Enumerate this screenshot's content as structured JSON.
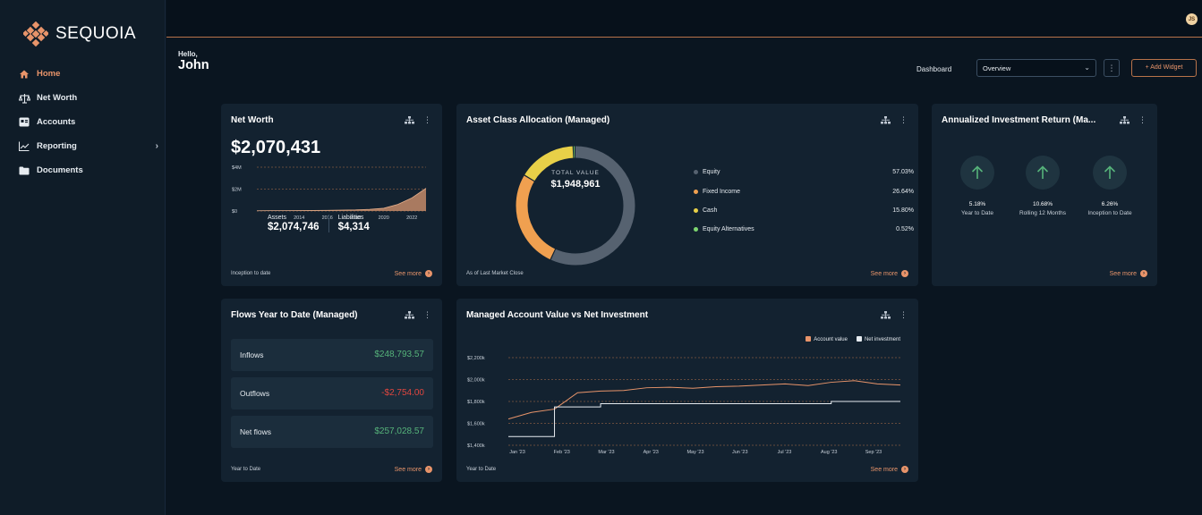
{
  "brand": {
    "name": "SEQUOIA",
    "accent": "#e8946a"
  },
  "sidebar": {
    "items": [
      {
        "label": "Home",
        "icon": "home-icon",
        "active": true
      },
      {
        "label": "Net Worth",
        "icon": "scale-icon"
      },
      {
        "label": "Accounts",
        "icon": "accounts-icon"
      },
      {
        "label": "Reporting",
        "icon": "chart-line-icon",
        "has_submenu": true
      },
      {
        "label": "Documents",
        "icon": "folder-icon"
      }
    ]
  },
  "header": {
    "avatar_initials": "JS",
    "hello": "Hello,",
    "name": "John"
  },
  "toolbar": {
    "dashboard_label": "Dashboard",
    "dashboard_selected": "Overview",
    "kebab": "⋮",
    "add_widget": "+ Add Widget"
  },
  "net_worth": {
    "title": "Net Worth",
    "value": "$2,070,431",
    "assets_label": "Assets",
    "assets_value": "$2,074,746",
    "liabilities_label": "Liabilities",
    "liabilities_value": "$4,314",
    "footer": "Inception to date",
    "see_more": "See more",
    "chart_data": {
      "type": "area",
      "y_ticks": [
        "$4M",
        "$2M",
        "$0"
      ],
      "x_ticks": [
        "2014",
        "2016",
        "2018",
        "2020",
        "2022"
      ],
      "ylim": [
        0,
        4
      ],
      "x": [
        2011,
        2012,
        2013,
        2014,
        2015,
        2016,
        2017,
        2018,
        2019,
        2020,
        2021,
        2022,
        2023
      ],
      "values": [
        0.02,
        0.03,
        0.03,
        0.04,
        0.05,
        0.06,
        0.08,
        0.1,
        0.15,
        0.25,
        0.6,
        1.2,
        2.07
      ]
    }
  },
  "allocation": {
    "title": "Asset Class Allocation (Managed)",
    "center_label": "TOTAL VALUE",
    "center_value": "$1,948,961",
    "footer": "As of Last Market Close",
    "see_more": "See more",
    "chart_data": {
      "type": "pie",
      "categories": [
        "Equity",
        "Fixed Income",
        "Cash",
        "Equity Alternatives"
      ],
      "values": [
        57.03,
        26.64,
        15.8,
        0.52
      ],
      "labels": [
        "57.03%",
        "26.64%",
        "15.80%",
        "0.52%"
      ],
      "colors": [
        "#566270",
        "#f0a050",
        "#e8d048",
        "#7ed670"
      ]
    }
  },
  "returns": {
    "title": "Annualized Investment Return (Ma...",
    "items": [
      {
        "value": "5.18%",
        "label": "Year to Date"
      },
      {
        "value": "10.68%",
        "label": "Rolling 12 Months"
      },
      {
        "value": "6.26%",
        "label": "Inception to Date"
      }
    ],
    "see_more": "See more"
  },
  "flows": {
    "title": "Flows Year to Date (Managed)",
    "rows": [
      {
        "label": "Inflows",
        "value": "$248,793.57",
        "tone": "green"
      },
      {
        "label": "Outflows",
        "value": "-$2,754.00",
        "tone": "red"
      },
      {
        "label": "Net flows",
        "value": "$257,028.57",
        "tone": "green"
      }
    ],
    "footer": "Year to Date",
    "see_more": "See more"
  },
  "managed_chart": {
    "title": "Managed Account Value vs Net Investment",
    "footer": "Year to Date",
    "see_more": "See more",
    "chart_data": {
      "type": "line",
      "y_ticks": [
        "$2,200k",
        "$2,000k",
        "$1,800k",
        "$1,600k",
        "$1,400k"
      ],
      "x_ticks": [
        "Jan '23",
        "Feb '23",
        "Mar '23",
        "Apr '23",
        "May '23",
        "Jun '23",
        "Jul '23",
        "Aug '23",
        "Sep '23"
      ],
      "ylim": [
        1400,
        2200
      ],
      "series": [
        {
          "name": "Account value",
          "color": "#e8946a",
          "values": [
            1640,
            1700,
            1730,
            1880,
            1895,
            1900,
            1925,
            1930,
            1920,
            1935,
            1940,
            1950,
            1960,
            1945,
            1975,
            1990,
            1960,
            1950
          ]
        },
        {
          "name": "Net investment",
          "color": "#e6ebf0",
          "values": [
            1480,
            1480,
            1750,
            1750,
            1780,
            1780,
            1780,
            1780,
            1780,
            1780,
            1780,
            1780,
            1780,
            1780,
            1800,
            1800,
            1800,
            1800
          ]
        }
      ]
    }
  }
}
